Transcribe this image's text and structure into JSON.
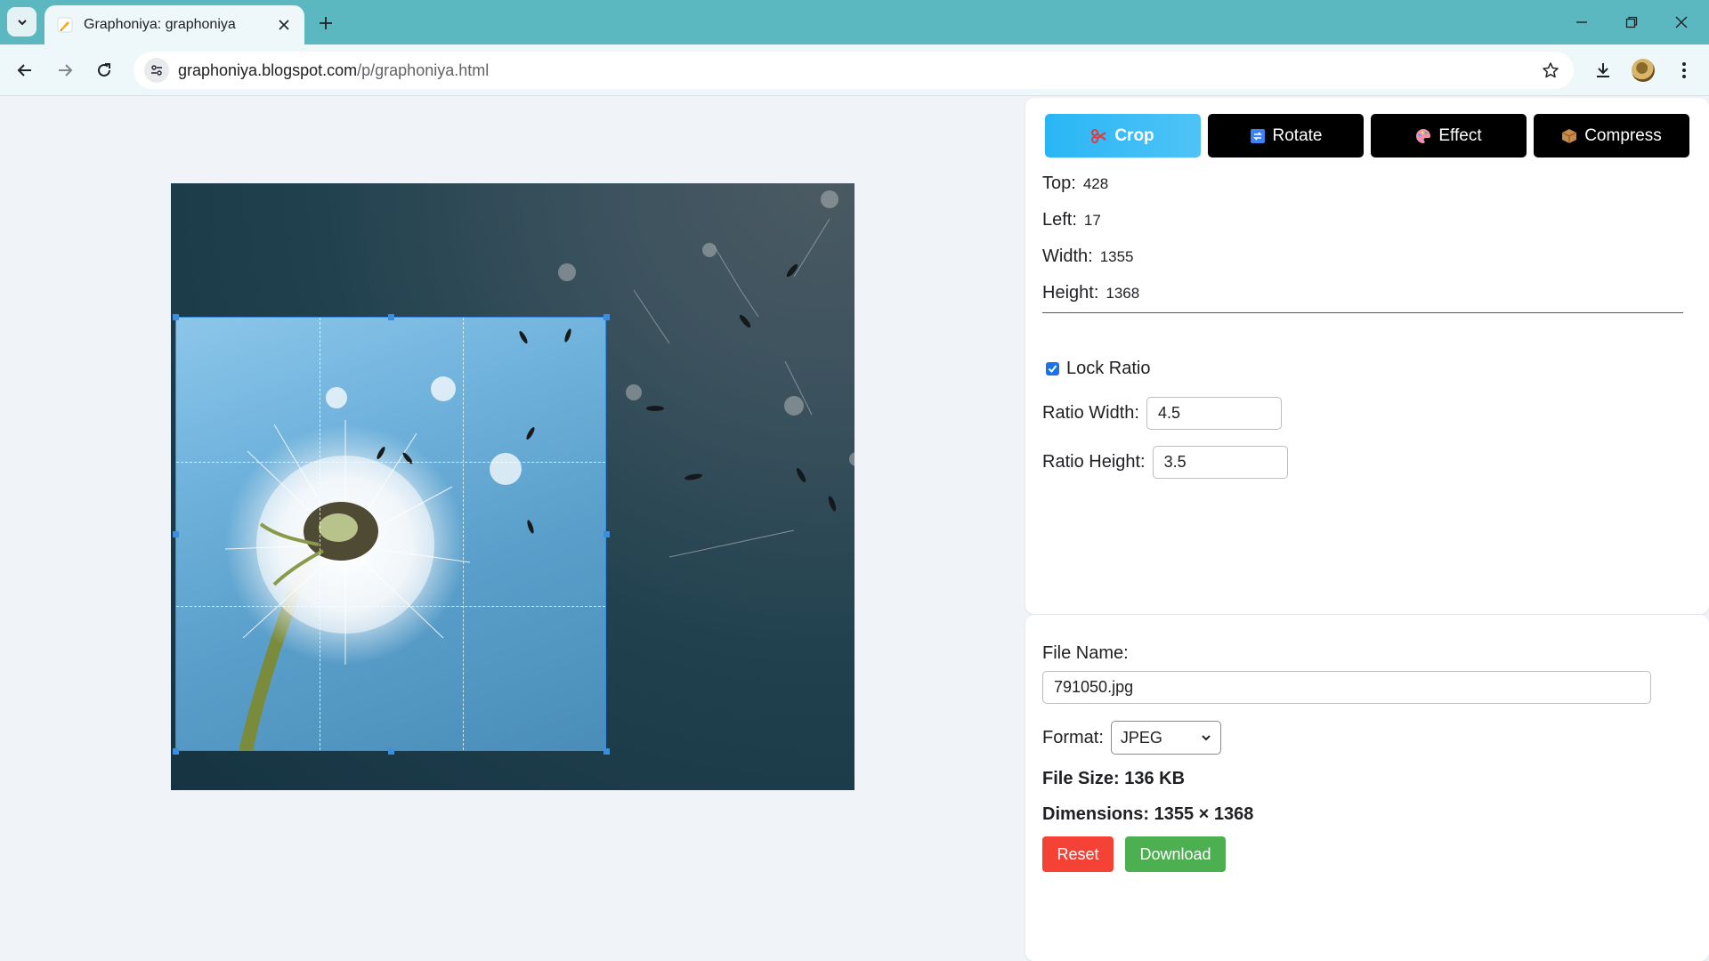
{
  "browser": {
    "tab_title": "Graphoniya: graphoniya",
    "url_host": "graphoniya.blogspot.com",
    "url_path": "/p/graphoniya.html"
  },
  "tools": {
    "crop": "Crop",
    "rotate": "Rotate",
    "effect": "Effect",
    "compress": "Compress"
  },
  "crop_fields": {
    "top_label": "Top:",
    "top_value": "428",
    "left_label": "Left:",
    "left_value": "17",
    "width_label": "Width:",
    "width_value": "1355",
    "height_label": "Height:",
    "height_value": "1368"
  },
  "ratio": {
    "lock_label": "Lock Ratio",
    "lock_checked": true,
    "width_label": "Ratio Width:",
    "width_value": "4.5",
    "height_label": "Ratio Height:",
    "height_value": "3.5"
  },
  "file": {
    "name_label": "File Name:",
    "name_value": "791050.jpg",
    "format_label": "Format:",
    "format_value": "JPEG",
    "size_text": "File Size: 136 KB",
    "dimensions_text": "Dimensions: 1355 × 1368",
    "reset_label": "Reset",
    "download_label": "Download"
  },
  "colors": {
    "crop_active": "#29b6f6",
    "tool_button": "#000000",
    "reset": "#f44336",
    "download": "#4caf50",
    "tab_strip": "#5bb8c1"
  }
}
